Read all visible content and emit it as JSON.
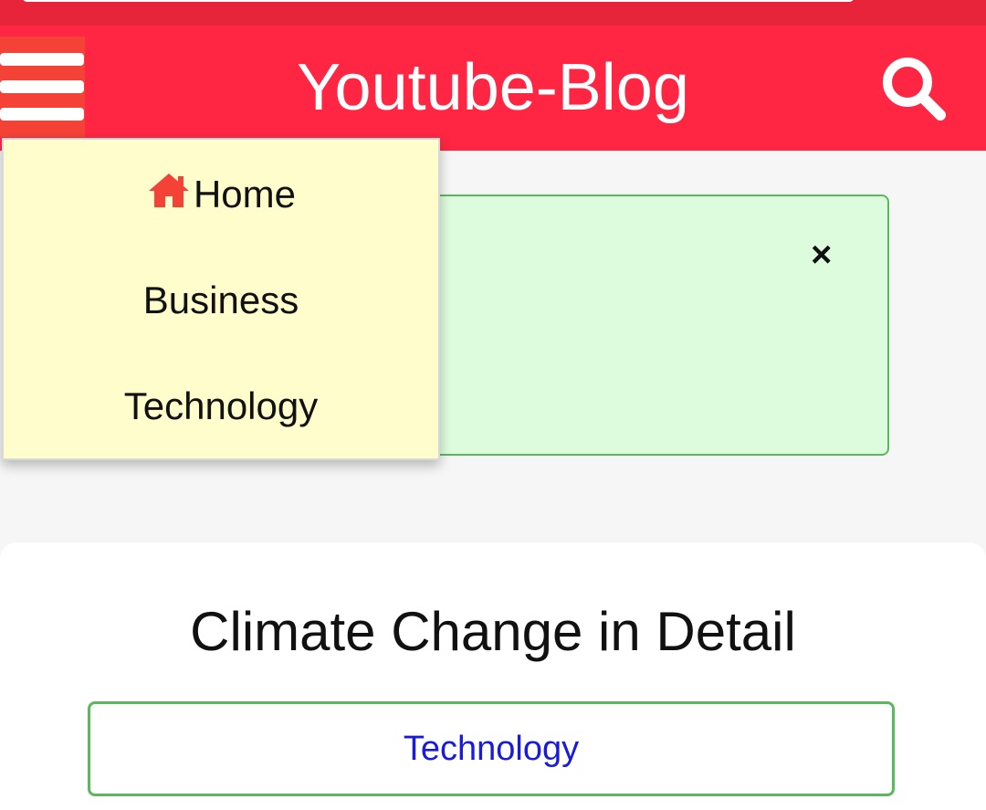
{
  "header": {
    "site_title": "Youtube-Blog",
    "menu_icon": "hamburger-menu-icon",
    "search_icon": "search-icon",
    "colors": {
      "header_bg": "#fe2642",
      "menu_btn_bg": "#f44236"
    }
  },
  "dropdown": {
    "items": [
      {
        "label": "Home",
        "icon": "home-icon"
      },
      {
        "label": "Business"
      },
      {
        "label": "Technology"
      }
    ],
    "colors": {
      "bg": "#fffdcc",
      "home_icon": "#f44236"
    }
  },
  "notice": {
    "close_label": "×",
    "colors": {
      "bg": "#ddfbdd",
      "border": "#5cb85c"
    }
  },
  "post": {
    "title": "Climate Change in Detail",
    "category": "Technology",
    "colors": {
      "category_text": "#1a1adb",
      "category_border": "#5cb85c"
    }
  }
}
